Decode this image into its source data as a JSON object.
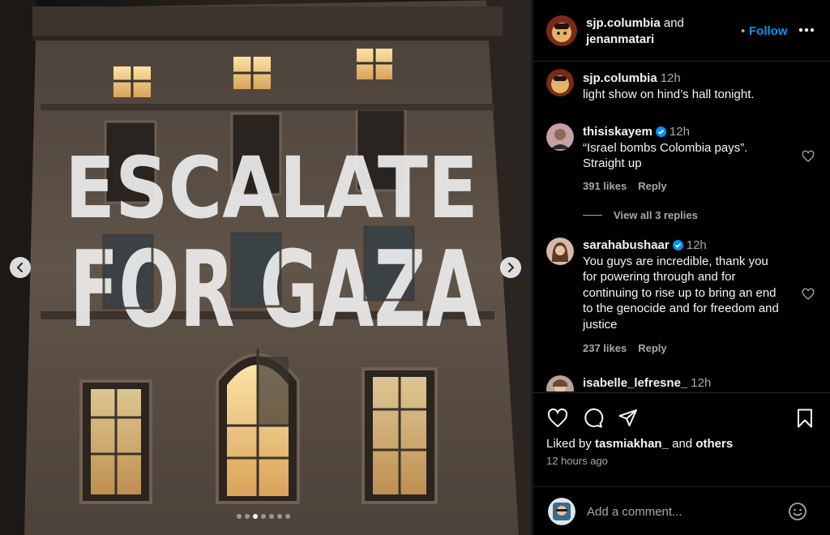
{
  "post": {
    "author_primary": "sjp.columbia",
    "and_text": "and",
    "author_secondary": "jenanmatari",
    "follow_label": "Follow",
    "follow_separator": "•"
  },
  "media": {
    "projection_line1": "ESCALATE",
    "projection_line2": "FOR GAZA",
    "total_slides": 7,
    "active_slide": 3,
    "colors": {
      "projection": "#e8e8e8",
      "wall": "#5a4f45",
      "window_light": "#f6d58a"
    }
  },
  "comments": [
    {
      "username": "sjp.columbia",
      "time": "12h",
      "verified": false,
      "lines": [
        "light show on hind’s hall tonight."
      ]
    },
    {
      "username": "thisiskayem",
      "time": "12h",
      "verified": true,
      "lines": [
        "“Israel bombs Colombia pays”.",
        "Straight up"
      ],
      "likes": "391 likes",
      "reply_label": "Reply",
      "view_replies": "View all 3 replies"
    },
    {
      "username": "sarahabushaar",
      "time": "12h",
      "verified": true,
      "lines": [
        "You guys are incredible, thank you",
        "for powering through and for",
        "continuing to rise up to bring an end",
        "to the genocide and for freedom and",
        "justice"
      ],
      "likes": "237 likes",
      "reply_label": "Reply"
    },
    {
      "username": "isabelle_lefresne_",
      "time": "12h",
      "verified": false,
      "lines": []
    }
  ],
  "footer": {
    "liked_by_prefix": "Liked by",
    "liked_by_user": "tasmiakhan_",
    "liked_by_and": "and",
    "liked_by_others": "others",
    "time_ago": "12 hours ago",
    "add_comment_placeholder": "Add a comment..."
  },
  "colors": {
    "link": "#0095f6",
    "verified": "#0095f6",
    "muted": "#a8a8a8",
    "background": "#000000"
  }
}
